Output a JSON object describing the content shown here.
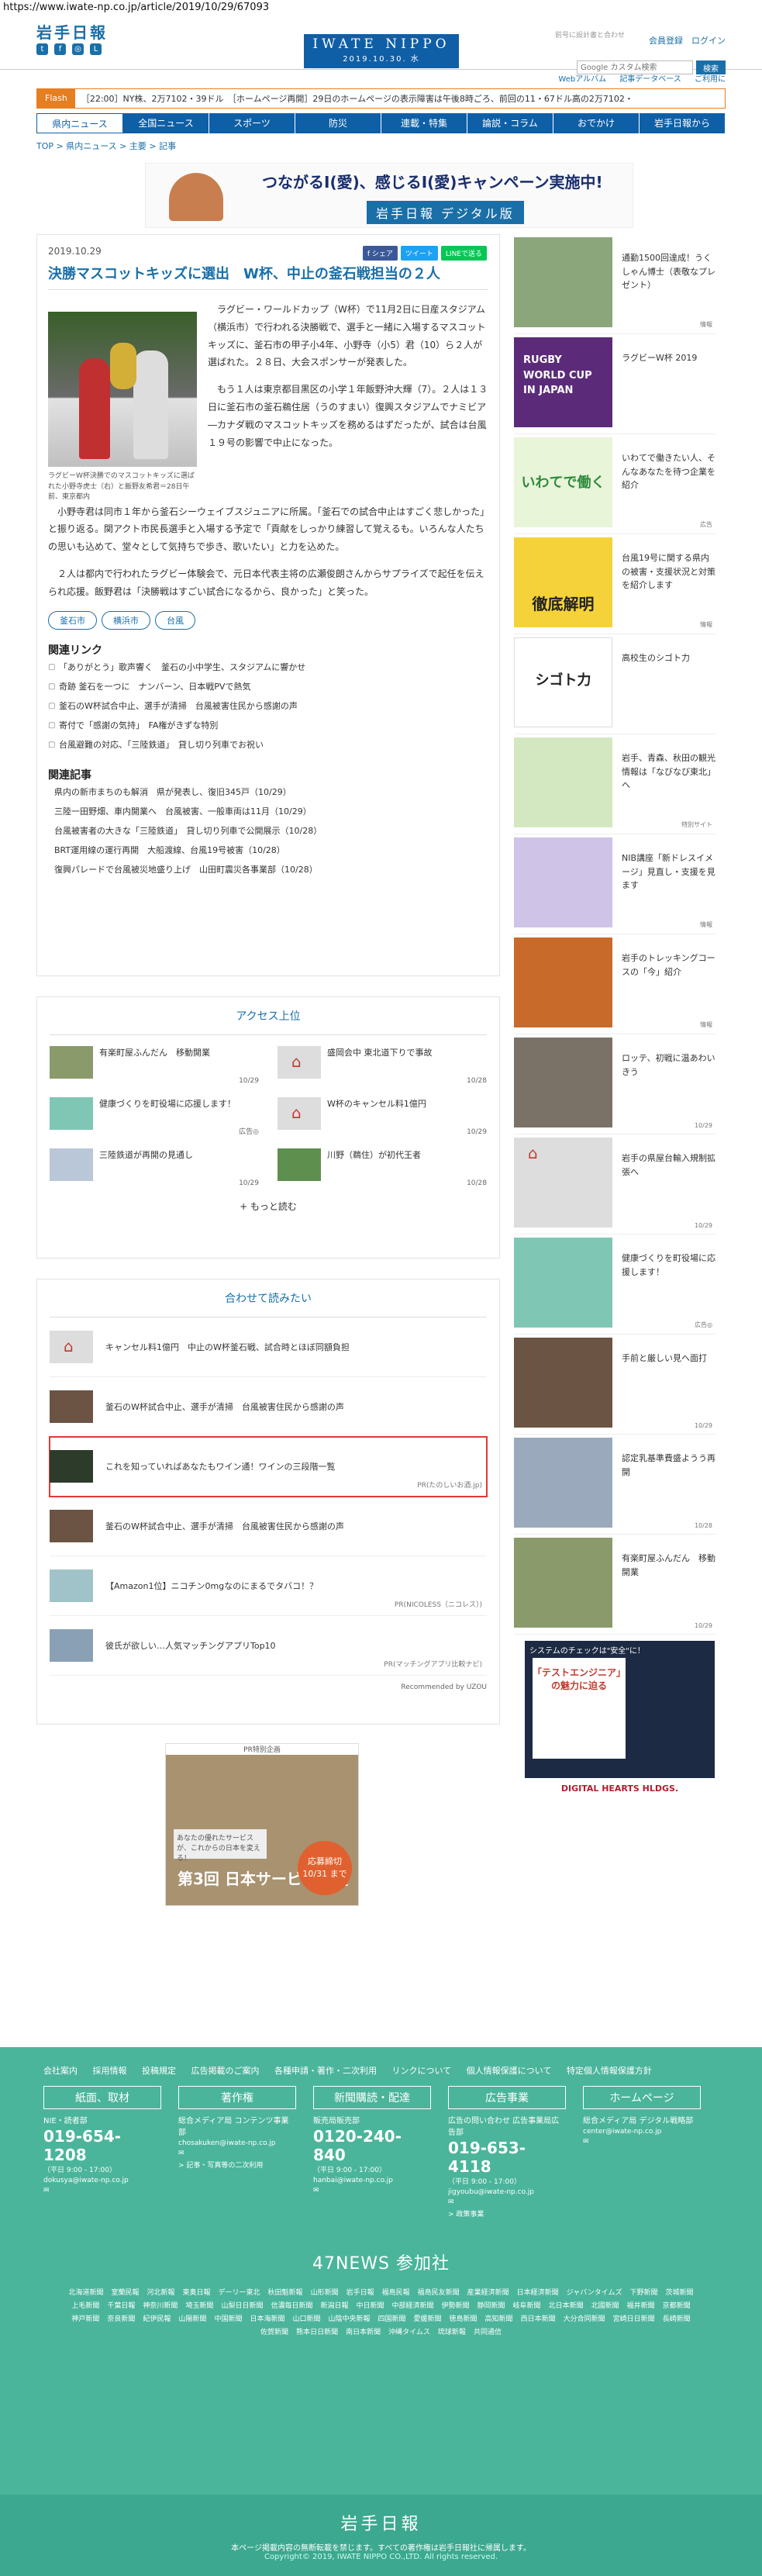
{
  "url": "https://www.iwate-np.co.jp/article/2019/10/29/67093",
  "header": {
    "logo": "岩手日報",
    "brand": "IWATE NIPPO",
    "date_line": "2019.10.30. 水",
    "notice": "前号に設計書と合わせ",
    "links": "会員登録　ログイン",
    "search_placeholder": "Google カスタム検索",
    "search_button": "検索",
    "subnav": [
      "Webアルバム",
      "記事データベース",
      "ご利用に"
    ]
  },
  "flash": {
    "tag": "Flash",
    "text": "［22:00］NY株、2万7102・39ドル　［ホームページ再開］29日のホームページの表示障害は午後8時ごろ、前回の11・67ドル高の2万7102・"
  },
  "gnav": [
    "県内ニュース",
    "全国ニュース",
    "スポーツ",
    "防災",
    "連載・特集",
    "論説・コラム",
    "おでかけ",
    "岩手日報から"
  ],
  "breadcrumb": "TOP > 県内ニュース > 主要 > 記事",
  "banner": {
    "title": "つながるI(愛)、感じるI(愛)キャンペーン実施中!",
    "sub": "岩手日報 デジタル版"
  },
  "article": {
    "date": "2019.10.29",
    "share": [
      "f シェア",
      "ツイート",
      "LINEで送る"
    ],
    "headline": "決勝マスコットキッズに選出　W杯、中止の釜石戦担当の２人",
    "caption": "ラグビーW杯決勝でのマスコットキッズに選ばれた小野寺虎士（右）と飯野友希君＝28日午前、東京都内",
    "paragraphs": [
      "ラグビー・ワールドカップ（W杯）で11月2日に日産スタジアム（横浜市）で行われる決勝戦で、選手と一緒に入場するマスコットキッズに、釜石市の甲子小4年、小野寺（小5）君（10）ら２人が選ばれた。２８日、大会スポンサーが発表した。",
      "もう１人は東京都目黒区の小学１年飯野沖大輝（7）。２人は１３日に釜石市の釜石鵜住居（うのすまい）復興スタジアムでナミビア―カナダ戦のマスコットキッズを務めるはずだったが、試合は台風１９号の影響で中止になった。",
      "小野寺君は同市１年から釜石シーウェイブスジュニアに所属。「釜石での試合中止はすごく悲しかった」と振り返る。関アクト市民長選手と入場する予定で「貢献をしっかり練習して覚えるも。いろんな人たちの思いも込めて、堂々として気持ちで歩き、歌いたい」と力を込めた。",
      "２人は都内で行われたラグビー体験会で、元日本代表主将の広瀬俊朗さんからサプライズで起任を伝えられ応援。飯野君は「決勝戦はすごい試合になるから、良かった」と笑った。"
    ],
    "tags": [
      "釜石市",
      "横浜市",
      "台風"
    ],
    "related_links_title": "関連リンク",
    "related_links": [
      "「ありがとう」歌声響く　釜石の小中学生、スタジアムに響かせ",
      "奇跡 釜石を一つに　ナンバーン、日本戦PVで熱気",
      "釜石のW杯試合中止、選手が清掃　台風被害住民から感謝の声",
      "寄付で「感謝の気持」　FA権がきずな特別",
      "台風避難の対応、「三陸鉄道」　貸し切り列車でお祝い"
    ],
    "related_articles_title": "関連記事",
    "related_articles": [
      "県内の新市まちのも解消　県が発表し、復旧345戸（10/29）",
      "三陸一田野畑、車内開業へ　台風被害、一般車両は11月（10/29）",
      "台風被害者の大きな「三陸鉄道」　貸し切り列車で公開展示（10/28）",
      "BRT運用線の運行再開　大船渡線、台風19号被害（10/28）",
      "復興パレードで台風被災地盛り上げ　山田町震災各事業部（10/28）"
    ]
  },
  "access": {
    "title": "アクセス上位",
    "items": [
      {
        "title": "有楽町屋ふんだん　移動開業",
        "date": "10/29"
      },
      {
        "title": "盛岡会中 東北道下りで事故",
        "date": "10/28"
      },
      {
        "title": "健康づくりを町役場に応援します！",
        "date": "広告◎"
      },
      {
        "title": "W杯のキャンセル料1億円",
        "date": "10/29"
      },
      {
        "title": "三陸鉄道が再開の見通し",
        "date": "10/29"
      },
      {
        "title": "川野（鵜住）が初代王者",
        "date": "10/28"
      }
    ],
    "more": "+ もっと読む"
  },
  "together": {
    "title": "合わせて読みたい",
    "items": [
      {
        "title": "キャンセル料1億円　中止のW杯釜石戦、試合時とほぼ同額負担",
        "pr": ""
      },
      {
        "title": "釜石のW杯試合中止、選手が清掃　台風被害住民から感謝の声",
        "pr": ""
      },
      {
        "title": "これを知っていればあなたもワイン通！ワインの三段階一覧",
        "pr": "PR(たのしいお酒.jp)"
      },
      {
        "title": "釜石のW杯試合中止、選手が清掃　台風被害住民から感謝の声",
        "pr": ""
      },
      {
        "title": "【Amazon1位】ニコチン0mgなのにまるでタバコ！？",
        "pr": "PR(NICOLESS（ニコレス）)"
      },
      {
        "title": "彼氏が欲しい…人気マッチングアプリTop10",
        "pr": "PR(マッチングアプリ比較ナビ)"
      }
    ],
    "recommend": "Recommended by ⁠UZOU"
  },
  "award_ad": {
    "top": "PR特別企画",
    "name": "第3回 日本サービス大賞",
    "badge": "応募締切 10/31 まで",
    "copy": "あなたの優れたサービスが、これからの日本を変える！"
  },
  "sidebar": [
    {
      "title": "通勤1500回達成！うくしゃん博士（表敬なプレゼント）",
      "date": "情報"
    },
    {
      "title": "ラグビーW杯 2019",
      "date": ""
    },
    {
      "title": "いわてで働きたい人、そんなあなたを待つ企業を紹介",
      "date": "広告"
    },
    {
      "title": "台風19号に関する県内の被害・支援状況と対策を紹介します",
      "date": "情報"
    },
    {
      "title": "高校生のシゴト力",
      "date": ""
    },
    {
      "title": "岩手、青森、秋田の観光情報は「なびなび東北」へ",
      "date": "特別サイト"
    },
    {
      "title": "NIB講座「新ドレスイメージ」見直し・支援を見ます",
      "date": "情報"
    },
    {
      "title": "岩手のトレッキングコースの「今」紹介",
      "date": "情報"
    },
    {
      "title": "ロッテ、初戦に温あわいきう",
      "date": "10/29"
    },
    {
      "title": "岩手の県屋台輸入規制拡張へ",
      "date": "10/29"
    },
    {
      "title": "健康づくりを町役場に応援します！",
      "date": "広告◎"
    },
    {
      "title": "手前と厳しい見へ面打",
      "date": "10/29"
    },
    {
      "title": "認定乳基準費盛ようう再開",
      "date": "10/28"
    },
    {
      "title": "有楽町屋ふんだん　移動開業",
      "date": "10/29"
    }
  ],
  "side_ad": {
    "head": "システムのチェックは\"安全\"に！",
    "copy": "「テストエンジニア」の魅力に迫る",
    "company": "DIGITAL HEARTS HLDGS."
  },
  "footer": {
    "links": [
      "会社案内",
      "採用情報",
      "投稿規定",
      "広告掲載のご案内",
      "各種申請・著作・二次利用",
      "リンクについて",
      "個人情報保護について",
      "特定個人情報保護方針"
    ],
    "cols": [
      {
        "head": "紙面、取材",
        "l1": "NIE・読者部",
        "big": "019-654-1208",
        "s": "（平日 9:00 - 17:00）",
        "mail": "dokusya@iwate-np.co.jp",
        "extra": ""
      },
      {
        "head": "著作権",
        "l1": "総合メディア局 コンテンツ事業部",
        "big": "",
        "s": "",
        "mail": "chosakuken@iwate-np.co.jp",
        "extra": "> 記事・写真等の二次利用"
      },
      {
        "head": "新聞購読・配達",
        "l1": "販売局販売部",
        "big": "0120-240-840",
        "s": "（平日 9:00 - 17:00）",
        "mail": "hanbai@iwate-np.co.jp",
        "extra": ""
      },
      {
        "head": "広告事業",
        "l1": "広告の問い合わせ 広告事業局広告部",
        "big": "019-653-4118",
        "s": "（平日 9:00 - 17:00）",
        "mail": "jigyoubu@iwate-np.co.jp",
        "extra": "> 政策事業"
      },
      {
        "head": "ホームページ",
        "l1": "総合メディア局 デジタル戦略部",
        "big": "",
        "s": "",
        "mail": "center@iwate-np.co.jp",
        "extra": ""
      }
    ],
    "news_title": "47NEWS 参加社",
    "news_list": [
      "北海道新聞",
      "室蘭民報",
      "河北新報",
      "東奥日報",
      "デーリー東北",
      "秋田魁新報",
      "山形新聞",
      "岩手日報",
      "福島民報",
      "福島民友新聞",
      "産業経済新聞",
      "日本経済新聞",
      "ジャパンタイムズ",
      "下野新聞",
      "茨城新聞",
      "上毛新聞",
      "千葉日報",
      "神奈川新聞",
      "埼玉新聞",
      "山梨日日新聞",
      "信濃毎日新聞",
      "新潟日報",
      "中日新聞",
      "中部経済新聞",
      "伊勢新聞",
      "静岡新聞",
      "岐阜新聞",
      "北日本新聞",
      "北國新聞",
      "福井新聞",
      "京都新聞",
      "神戸新聞",
      "奈良新聞",
      "紀伊民報",
      "山陽新聞",
      "中国新聞",
      "日本海新聞",
      "山口新聞",
      "山陰中央新報",
      "四国新聞",
      "愛媛新聞",
      "徳島新聞",
      "高知新聞",
      "西日本新聞",
      "大分合同新聞",
      "宮崎日日新聞",
      "長崎新聞",
      "佐賀新聞",
      "熊本日日新聞",
      "南日本新聞",
      "沖縄タイムス",
      "琉球新報",
      "共同通信"
    ],
    "logo": "岩手日報",
    "note": "本ページ掲載内容の無断転載を禁じます。すべての著作権は岩手日報社に帰属します。",
    "copyright": "Copyright© 2019, IWATE NIPPO CO.,LTD. All rights reserved."
  },
  "colors": {
    "brand": "#0f5fa6",
    "footer": "#4ab59b",
    "flash": "#e67e22",
    "highlight": "#e53935"
  }
}
